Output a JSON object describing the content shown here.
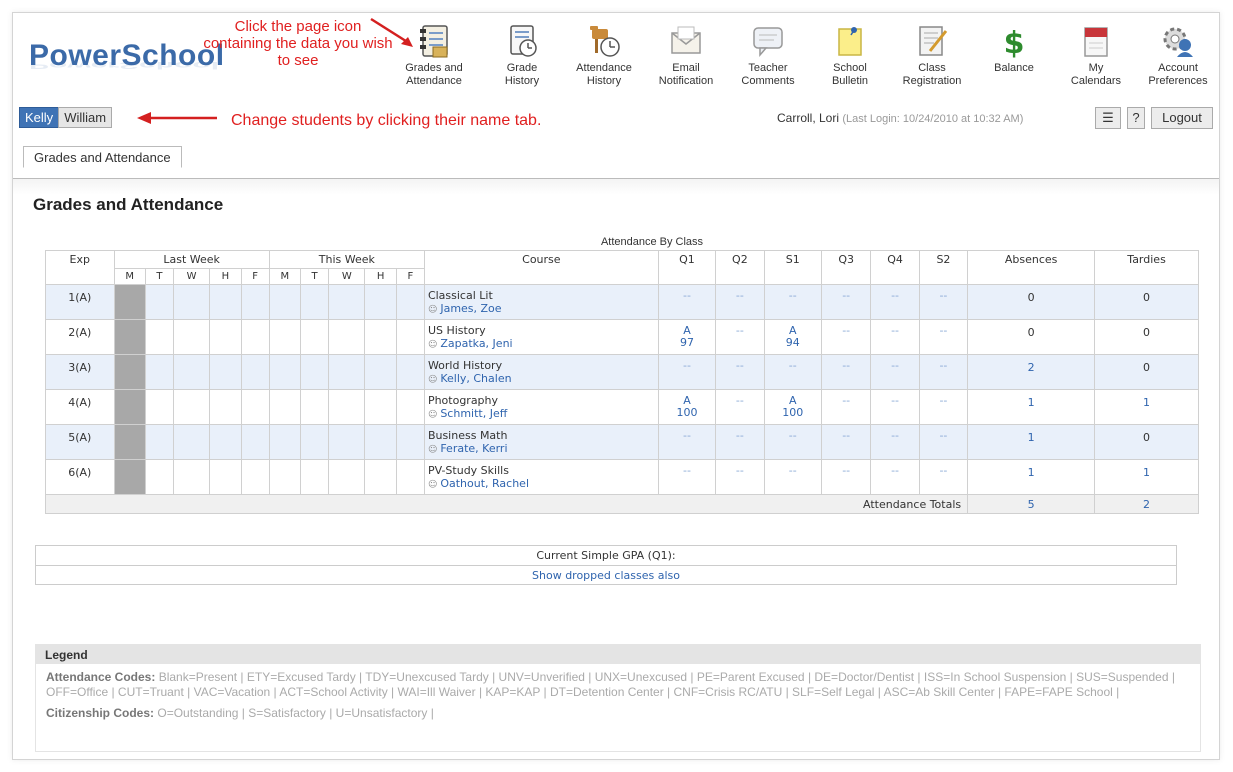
{
  "app": {
    "logo": "PowerSchool"
  },
  "annotations": {
    "top": "Click the page icon containing the data you wish to see",
    "students": "Change students by clicking their name tab."
  },
  "nav": [
    {
      "icon": "grades-icon",
      "line1": "Grades and",
      "line2": "Attendance"
    },
    {
      "icon": "grade-history-icon",
      "line1": "Grade",
      "line2": "History"
    },
    {
      "icon": "attendance-history-icon",
      "line1": "Attendance",
      "line2": "History"
    },
    {
      "icon": "email-icon",
      "line1": "Email",
      "line2": "Notification"
    },
    {
      "icon": "comments-icon",
      "line1": "Teacher",
      "line2": "Comments"
    },
    {
      "icon": "bulletin-icon",
      "line1": "School",
      "line2": "Bulletin"
    },
    {
      "icon": "registration-icon",
      "line1": "Class",
      "line2": "Registration"
    },
    {
      "icon": "balance-icon",
      "line1": "Balance",
      "line2": ""
    },
    {
      "icon": "calendar-icon",
      "line1": "My",
      "line2": "Calendars"
    },
    {
      "icon": "preferences-icon",
      "line1": "Account",
      "line2": "Preferences"
    }
  ],
  "students": [
    "Kelly",
    "William"
  ],
  "user": {
    "name": "Carroll, Lori",
    "last_login": "(Last Login: 10/24/2010 at 10:32 AM)"
  },
  "toolbar": {
    "print": "☰",
    "help": "?",
    "logout": "Logout"
  },
  "tab": {
    "label": "Grades and Attendance"
  },
  "page": {
    "title": "Grades and Attendance"
  },
  "table": {
    "caption": "Attendance By Class",
    "headers": {
      "exp": "Exp",
      "last_week": "Last Week",
      "this_week": "This Week",
      "course": "Course",
      "q1": "Q1",
      "q2": "Q2",
      "s1": "S1",
      "q3": "Q3",
      "q4": "Q4",
      "s2": "S2",
      "absences": "Absences",
      "tardies": "Tardies"
    },
    "days": [
      "M",
      "T",
      "W",
      "H",
      "F"
    ],
    "rows": [
      {
        "exp": "1(A)",
        "course": "Classical Lit",
        "teacher": "James, Zoe",
        "q1": [
          "--"
        ],
        "q2": "--",
        "s1": [
          "--"
        ],
        "q3": "--",
        "q4": "--",
        "s2": "--",
        "absences": "0",
        "tardies": "0"
      },
      {
        "exp": "2(A)",
        "course": "US History",
        "teacher": "Zapatka, Jeni",
        "q1": [
          "A",
          "97"
        ],
        "q2": "--",
        "s1": [
          "A",
          "94"
        ],
        "q3": "--",
        "q4": "--",
        "s2": "--",
        "absences": "0",
        "tardies": "0"
      },
      {
        "exp": "3(A)",
        "course": "World History",
        "teacher": "Kelly, Chalen",
        "q1": [
          "--"
        ],
        "q2": "--",
        "s1": [
          "--"
        ],
        "q3": "--",
        "q4": "--",
        "s2": "--",
        "absences": "2",
        "tardies": "0"
      },
      {
        "exp": "4(A)",
        "course": "Photography",
        "teacher": "Schmitt, Jeff",
        "q1": [
          "A",
          "100"
        ],
        "q2": "--",
        "s1": [
          "A",
          "100"
        ],
        "q3": "--",
        "q4": "--",
        "s2": "--",
        "absences": "1",
        "tardies": "1"
      },
      {
        "exp": "5(A)",
        "course": "Business Math",
        "teacher": "Ferate, Kerri",
        "q1": [
          "--"
        ],
        "q2": "--",
        "s1": [
          "--"
        ],
        "q3": "--",
        "q4": "--",
        "s2": "--",
        "absences": "1",
        "tardies": "0"
      },
      {
        "exp": "6(A)",
        "course": "PV-Study Skills",
        "teacher": "Oathout, Rachel",
        "q1": [
          "--"
        ],
        "q2": "--",
        "s1": [
          "--"
        ],
        "q3": "--",
        "q4": "--",
        "s2": "--",
        "absences": "1",
        "tardies": "1"
      }
    ],
    "totals": {
      "label": "Attendance Totals",
      "absences": "5",
      "tardies": "2"
    }
  },
  "gpa": {
    "label": "Current Simple GPA (Q1):",
    "dropped_link": "Show dropped classes also"
  },
  "legend": {
    "title": "Legend",
    "attendance_label": "Attendance Codes:",
    "attendance_codes": "Blank=Present | ETY=Excused Tardy | TDY=Unexcused Tardy | UNV=Unverified | UNX=Unexcused | PE=Parent Excused | DE=Doctor/Dentist | ISS=In School Suspension | SUS=Suspended | OFF=Office | CUT=Truant | VAC=Vacation | ACT=School Activity | WAI=Ill Waiver | KAP=KAP | DT=Detention Center | CNF=Crisis RC/ATU | SLF=Self Legal | ASC=Ab Skill Center | FAPE=FAPE School |",
    "citizenship_label": "Citizenship Codes:",
    "citizenship_codes": "O=Outstanding | S=Satisfactory | U=Unsatisfactory |"
  },
  "colors": {
    "brand": "#3b6aa8",
    "link": "#2f64ae",
    "annotation": "#e02020",
    "row_shade": "#e9f0fa"
  }
}
